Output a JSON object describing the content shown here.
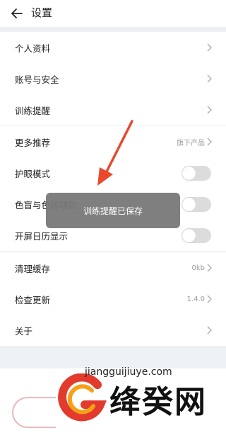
{
  "header": {
    "title": "设置"
  },
  "group1": [
    {
      "label": "个人资料"
    },
    {
      "label": "账号与安全"
    },
    {
      "label": "训练提醒"
    }
  ],
  "group2": [
    {
      "label": "更多推荐",
      "value": "旗下产品"
    }
  ],
  "group3": [
    {
      "label": "护眼模式",
      "on": false
    },
    {
      "label": "色盲与色弱辅助",
      "on": false
    },
    {
      "label": "开屏日历显示",
      "on": false
    }
  ],
  "group4": [
    {
      "label": "清理缓存",
      "value": "0kb"
    },
    {
      "label": "检查更新",
      "value": "1.4.0"
    },
    {
      "label": "关于"
    }
  ],
  "toast": {
    "text": "训练提醒已保存"
  },
  "watermark": {
    "url": "jiangguijiuye.com",
    "name": "绛癸网"
  },
  "colors": {
    "arrow": "#e84a2b",
    "toggle_off": "#dcdcdc",
    "background": "#eef1f4"
  }
}
